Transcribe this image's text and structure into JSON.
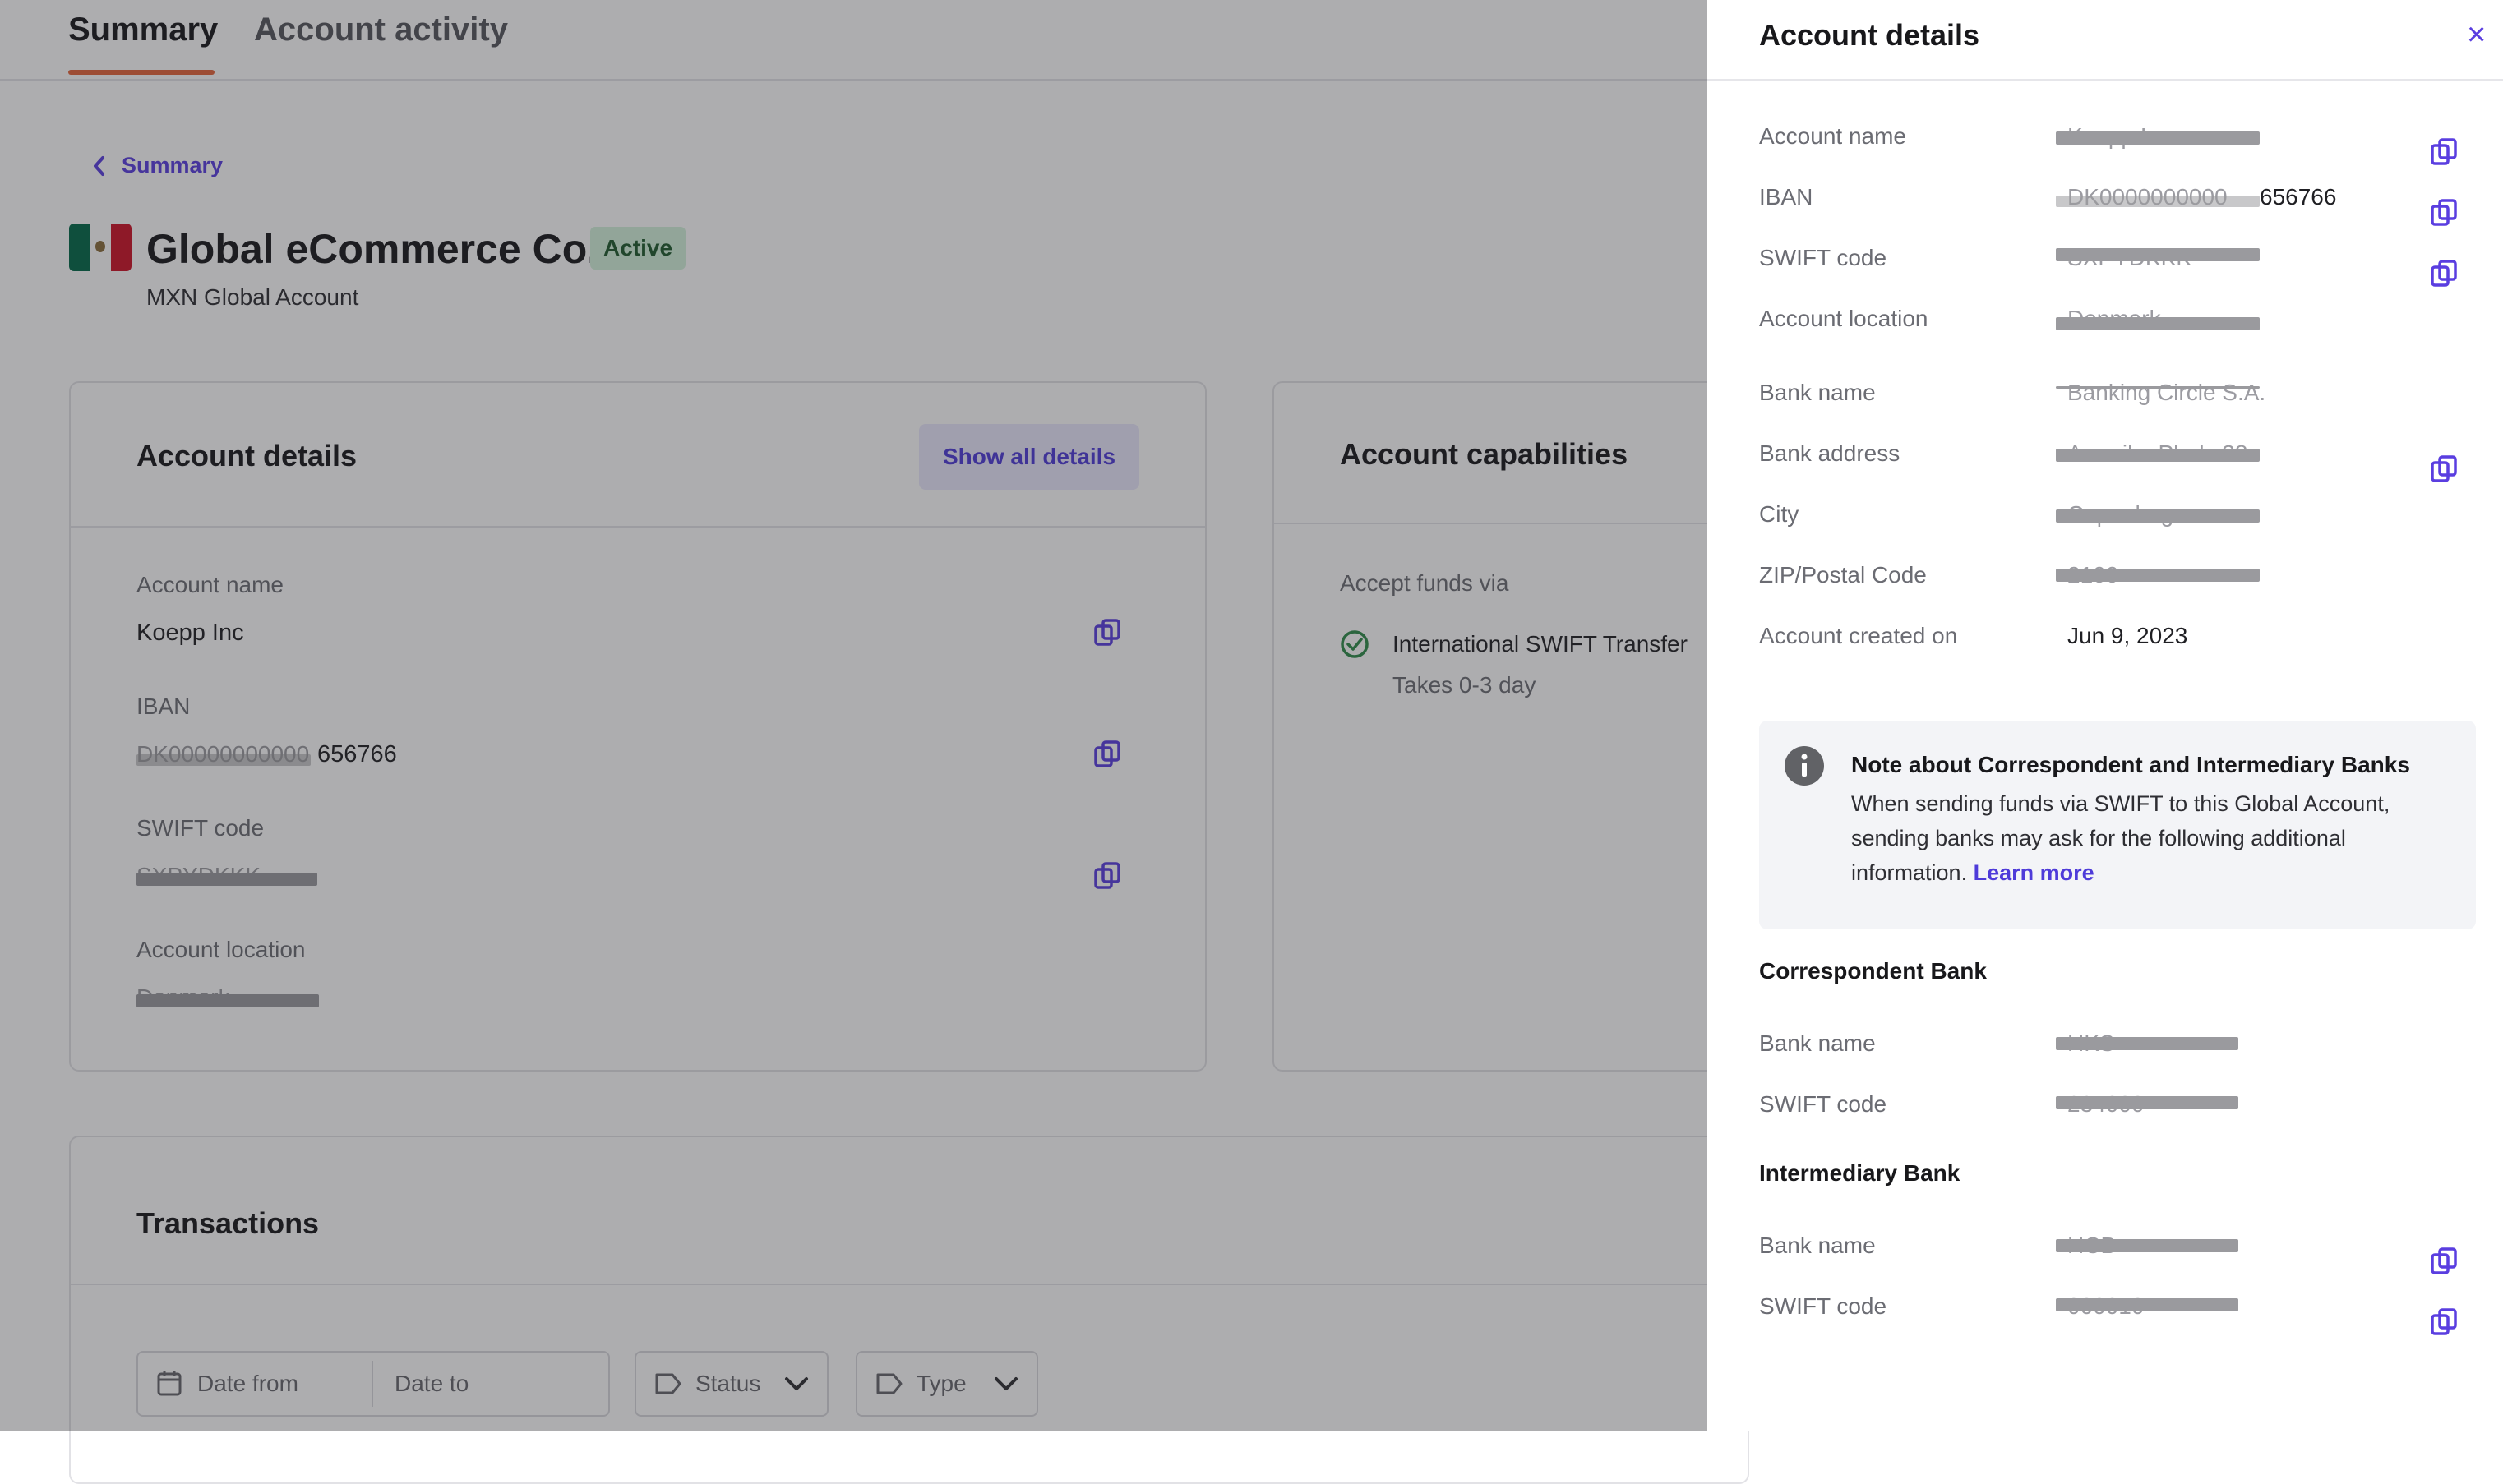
{
  "tabs": [
    {
      "label": "Summary",
      "active": true
    },
    {
      "label": "Account activity",
      "active": false
    }
  ],
  "breadcrumb": {
    "label": "Summary"
  },
  "account": {
    "title": "Global eCommerce Co.",
    "status": "Active",
    "subtitle": "MXN Global Account",
    "flag_colors": [
      "#006847",
      "#ffffff",
      "#ce1126"
    ]
  },
  "details_card": {
    "title": "Account details",
    "show_all_label": "Show all details",
    "fields": [
      {
        "label": "Account name",
        "value": "Koepp Inc"
      },
      {
        "label": "IBAN",
        "value_ghost": "DK00000000000",
        "value": "656766"
      },
      {
        "label": "SWIFT code",
        "value_ghost": "SXPYDKKK"
      },
      {
        "label": "Account location",
        "value_ghost": "Denmark"
      }
    ]
  },
  "capabilities_card": {
    "title": "Account capabilities",
    "accept_label": "Accept funds via",
    "method": "International SWIFT Transfer",
    "method_time": "Takes 0-3 day"
  },
  "transactions_card": {
    "title": "Transactions",
    "date_from_placeholder": "Date from",
    "date_to_placeholder": "Date to",
    "status_label": "Status",
    "type_label": "Type"
  },
  "drawer": {
    "title": "Account details",
    "close_label": "×",
    "fields": [
      {
        "label": "Account name",
        "ghost": "Koepp Inc"
      },
      {
        "label": "IBAN",
        "ghost": "DK0000000000",
        "value": "656766"
      },
      {
        "label": "SWIFT code",
        "ghost": "SXPYDKKK"
      },
      {
        "label": "Account location",
        "ghost": "Denmark"
      },
      {
        "label": "Bank name",
        "ghost": "Banking Circle S.A."
      },
      {
        "label": "Bank address",
        "ghost": "Amerika Plads 38"
      },
      {
        "label": "City",
        "ghost": "Copenhagen"
      },
      {
        "label": "ZIP/Postal Code",
        "ghost": "2100"
      },
      {
        "label": "Account created on",
        "value": "Jun 9, 2023"
      }
    ],
    "note": {
      "title": "Note about Correspondent and Intermediary Banks",
      "text": "When sending funds via SWIFT to this Global Account, sending banks may ask for the following additional information.",
      "link": "Learn more"
    },
    "correspondent": {
      "title": "Correspondent Bank",
      "fields": [
        {
          "label": "Bank name",
          "ghost": "HKS"
        },
        {
          "label": "SWIFT code",
          "ghost": "234000"
        }
      ]
    },
    "intermediary": {
      "title": "Intermediary Bank",
      "fields": [
        {
          "label": "Bank name",
          "ghost": "HCB"
        },
        {
          "label": "SWIFT code",
          "ghost": "000010"
        }
      ]
    }
  },
  "colors": {
    "accent": "#5a3ee0",
    "tab_underline": "#e5653b",
    "status_bg": "#d4f3dc",
    "success": "#2e8b4a"
  }
}
